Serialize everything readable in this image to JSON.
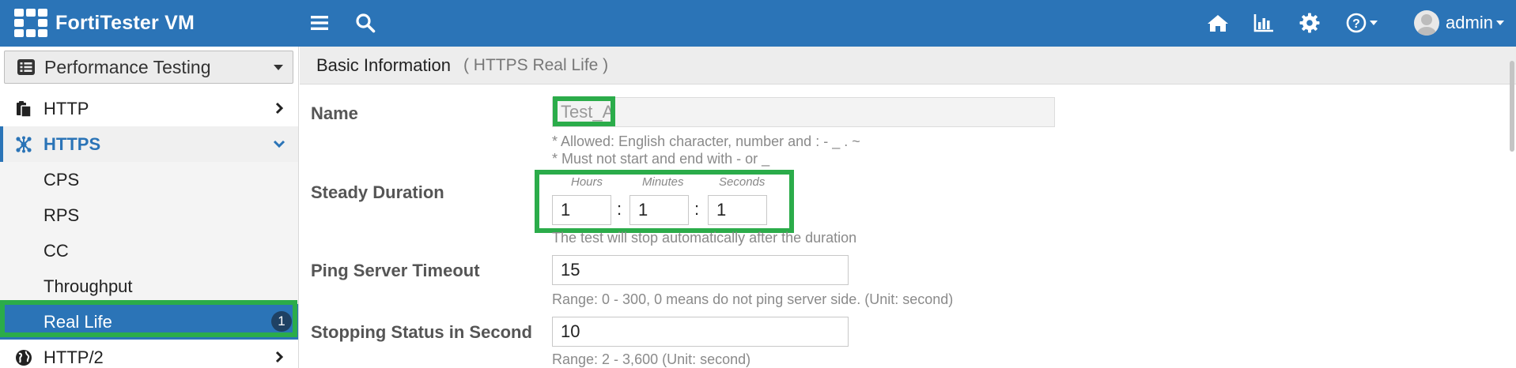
{
  "app": {
    "title": "FortiTester VM"
  },
  "header": {
    "user_label": "admin"
  },
  "sidebar": {
    "section": "Performance Testing",
    "items": [
      {
        "label": "HTTP"
      },
      {
        "label": "HTTPS"
      },
      {
        "label": "CPS"
      },
      {
        "label": "RPS"
      },
      {
        "label": "CC"
      },
      {
        "label": "Throughput"
      },
      {
        "label": "Real Life",
        "badge": "1"
      },
      {
        "label": "HTTP/2"
      }
    ]
  },
  "main": {
    "title": "Basic Information",
    "subtitle": "( HTTPS Real Life )",
    "name": {
      "label": "Name",
      "value": "Test_A",
      "help1": "* Allowed: English character, number and : - _ . ~",
      "help2": "* Must not start and end with - or _"
    },
    "steady": {
      "label": "Steady Duration",
      "hours_label": "Hours",
      "minutes_label": "Minutes",
      "seconds_label": "Seconds",
      "hours": "1",
      "minutes": "1",
      "seconds": "1",
      "separator": ":",
      "help": "The test will stop automatically after the duration"
    },
    "ping": {
      "label": "Ping Server Timeout",
      "value": "15",
      "help": "Range: 0 - 300, 0 means do not ping server side. (Unit: second)"
    },
    "stopping": {
      "label": "Stopping Status in Second",
      "value": "10",
      "help": "Range: 2 - 3,600 (Unit: second)"
    }
  },
  "colors": {
    "topbar": "#2b74b7",
    "highlight": "#2bac4a",
    "active": "#2b74b7"
  }
}
